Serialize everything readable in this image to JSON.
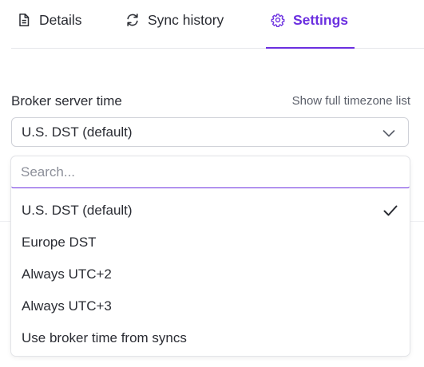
{
  "tabs": [
    {
      "label": "Details",
      "icon": "document-icon"
    },
    {
      "label": "Sync history",
      "icon": "refresh-icon"
    },
    {
      "label": "Settings",
      "icon": "gear-icon",
      "active": true
    }
  ],
  "colors": {
    "accent": "#6b2fe0",
    "text": "#2a2c33",
    "muted": "#5c606b",
    "border": "#cfd1d8"
  },
  "field": {
    "label": "Broker server time",
    "link": "Show full timezone list",
    "selected_value": "U.S. DST (default)",
    "chevron_icon": "chevron-down-icon"
  },
  "dropdown": {
    "search_placeholder": "Search...",
    "options": [
      {
        "label": "U.S. DST (default)",
        "selected": true
      },
      {
        "label": "Europe DST"
      },
      {
        "label": "Always UTC+2"
      },
      {
        "label": "Always UTC+3"
      },
      {
        "label": "Use broker time from syncs"
      }
    ],
    "check_icon": "check-icon"
  }
}
